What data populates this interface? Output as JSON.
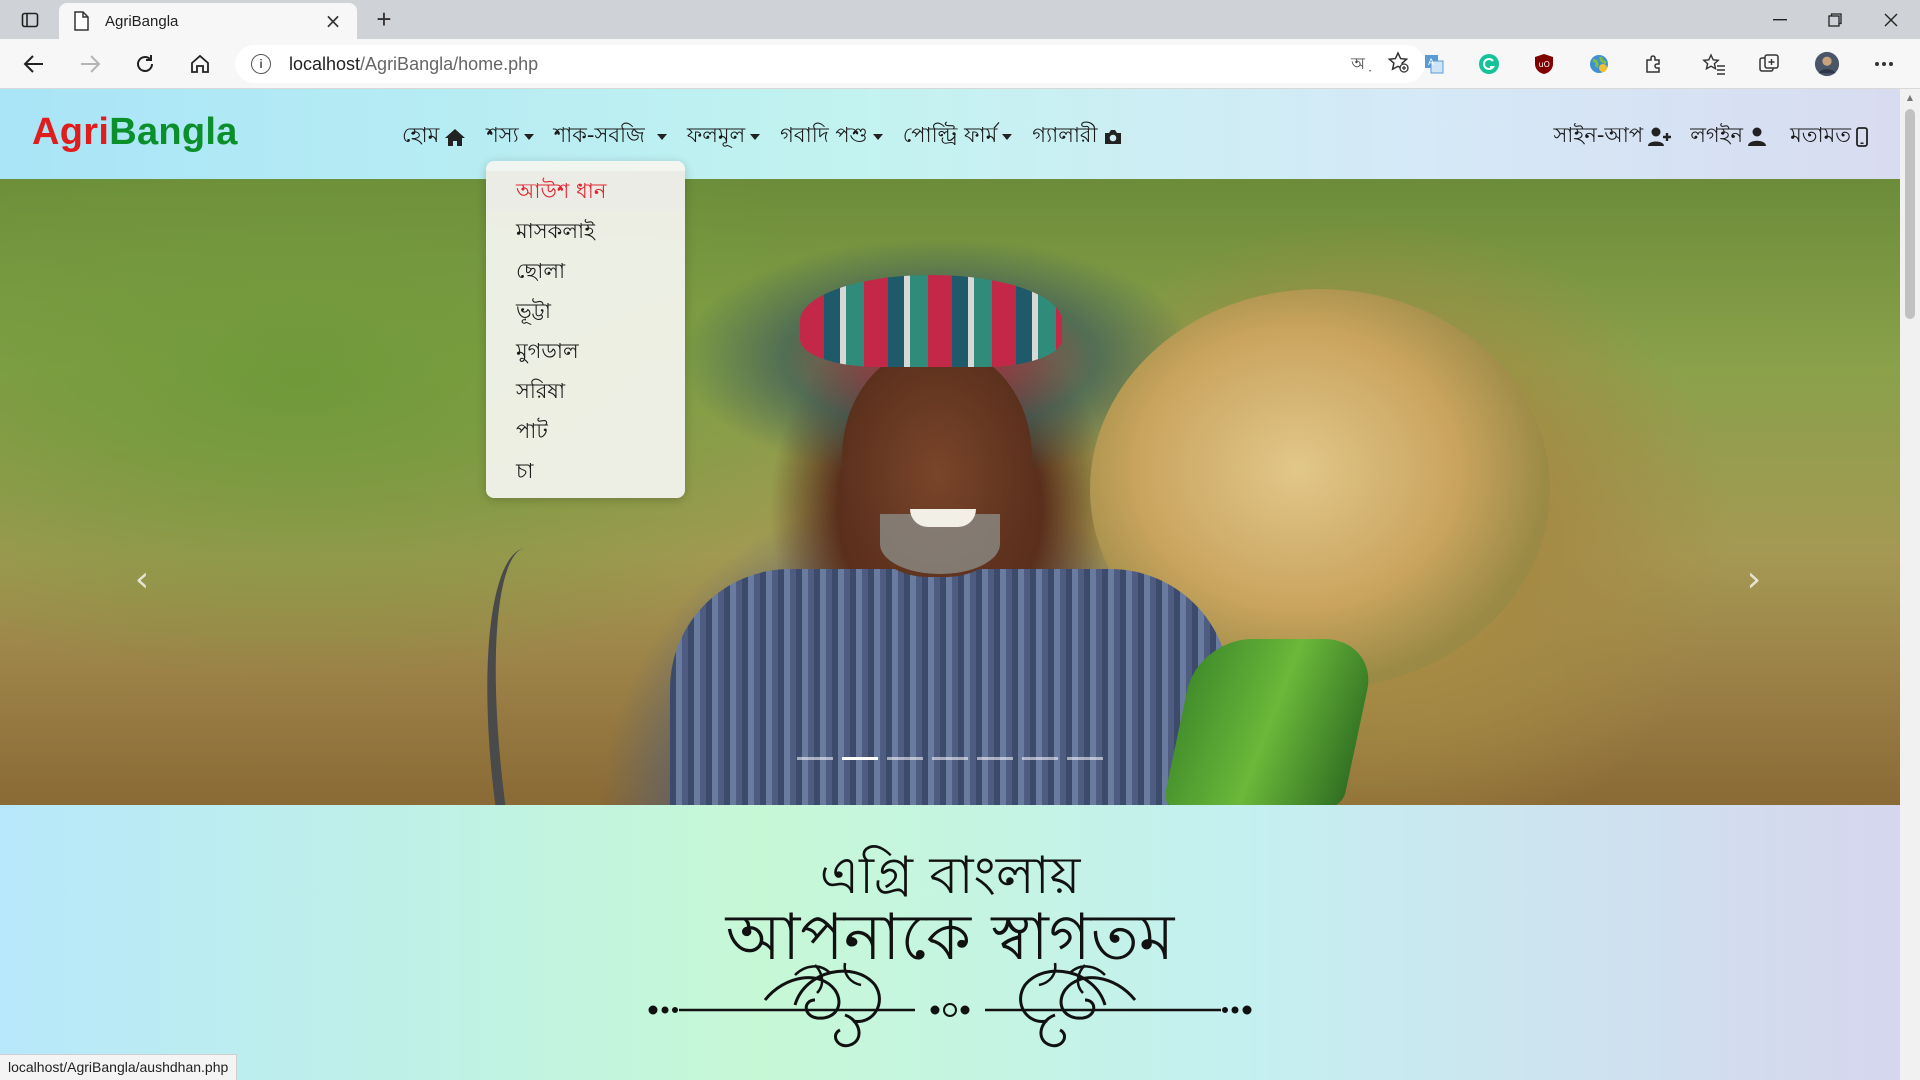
{
  "browser": {
    "tab_title": "AgriBangla",
    "url_host": "localhost",
    "url_path": "/AgriBangla/home.php",
    "status_url": "localhost/AgriBangla/aushdhan.php",
    "read_aloud_label": "অ়"
  },
  "site": {
    "logo_agri": "Agri",
    "logo_bangla": "Bangla",
    "nav": {
      "home": "হোম",
      "crops": "শস্য",
      "vegetables": "শাক-সবজি",
      "fruits": "ফলমূল",
      "livestock": "গবাদি পশু",
      "poultry": "পোল্ট্রি ফার্ম",
      "gallery": "গ্যালারী",
      "signup": "সাইন-আপ",
      "login": "লগইন",
      "feedback": "মতামত"
    },
    "crops_menu": [
      "আউশ ধান",
      "মাসকলাই",
      "ছোলা",
      "ভূট্টা",
      "মুগডাল",
      "সরিষা",
      "পাট",
      "চা"
    ],
    "welcome_line1": "এগ্রি বাংলায়",
    "welcome_line2": "আপনাকে স্বাগতম"
  },
  "carousel": {
    "slide_count": 7,
    "active_index": 1
  },
  "colors": {
    "logo_red": "#e01d1d",
    "logo_green": "#0a8f2a",
    "dropdown_active": "#e3232f"
  }
}
